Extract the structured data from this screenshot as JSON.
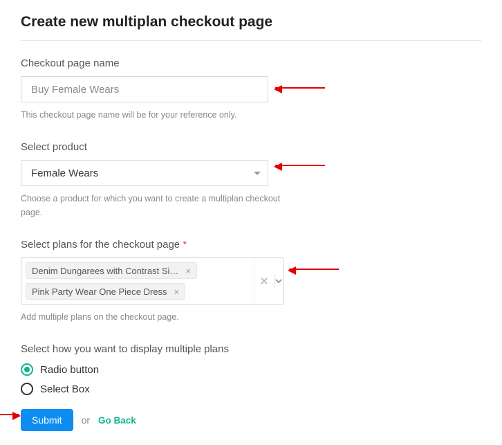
{
  "title": "Create new multiplan checkout page",
  "fields": {
    "name": {
      "label": "Checkout page name",
      "value": "Buy Female Wears",
      "helper": "This checkout page name will be for your reference only."
    },
    "product": {
      "label": "Select product",
      "value": "Female Wears",
      "helper": "Choose a product for which you want to create a multiplan checkout page."
    },
    "plans": {
      "label": "Select plans for the checkout page",
      "required_mark": "*",
      "selected": [
        "Denim Dungarees with Contrast Si…",
        "Pink Party Wear One Piece Dress"
      ],
      "helper": "Add multiple plans on the checkout page."
    },
    "display": {
      "label": "Select how you want to display multiple plans",
      "options": [
        "Radio button",
        "Select Box"
      ],
      "selected": "Radio button"
    }
  },
  "actions": {
    "submit": "Submit",
    "or": "or",
    "back": "Go Back"
  },
  "icons": {
    "clear": "×",
    "tag_close": "×"
  }
}
